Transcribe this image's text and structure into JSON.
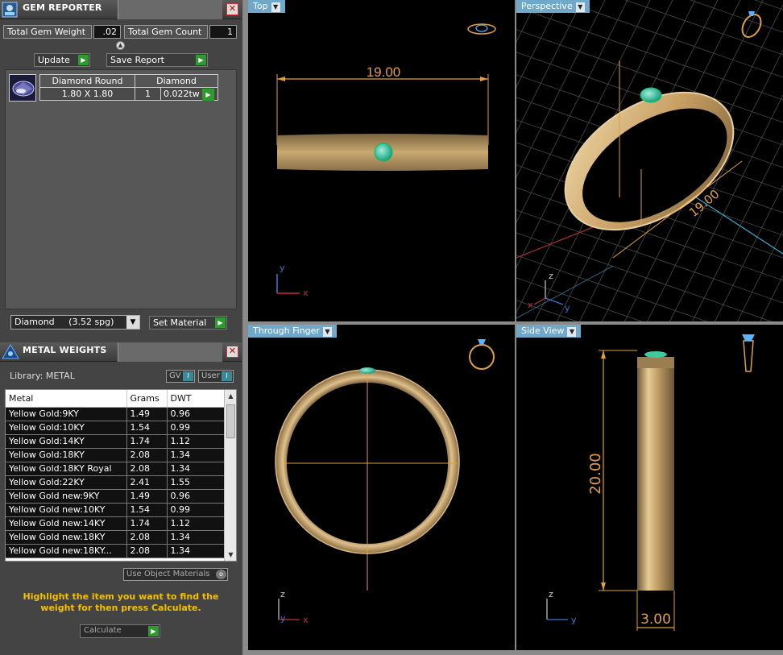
{
  "gem_reporter": {
    "title": "GEM REPORTER",
    "close": "✕",
    "total_weight_label": "Total Gem Weight",
    "total_weight_value": ".02",
    "total_count_label": "Total Gem Count",
    "total_count_value": "1",
    "update_label": "Update",
    "save_report_label": "Save Report",
    "gem": {
      "name": "Diamond Round",
      "material": "Diamond",
      "size": "1.80 X 1.80",
      "count": "1",
      "weight": "0.022tw"
    },
    "material_select": {
      "name": "Diamond",
      "spg": "(3.52 spg)"
    },
    "set_material_label": "Set Material"
  },
  "metal_weights": {
    "title": "METAL WEIGHTS",
    "close": "✕",
    "library_label": "Library: METAL",
    "gv_label": "GV",
    "user_label": "User",
    "columns": [
      "Metal",
      "Grams",
      "DWT"
    ],
    "rows": [
      [
        "Yellow Gold:9KY",
        "1.49",
        "0.96"
      ],
      [
        "Yellow Gold:10KY",
        "1.54",
        "0.99"
      ],
      [
        "Yellow Gold:14KY",
        "1.74",
        "1.12"
      ],
      [
        "Yellow Gold:18KY",
        "2.08",
        "1.34"
      ],
      [
        "Yellow Gold:18KY Royal",
        "2.08",
        "1.34"
      ],
      [
        "Yellow Gold:22KY",
        "2.41",
        "1.55"
      ],
      [
        "Yellow Gold new:9KY",
        "1.49",
        "0.96"
      ],
      [
        "Yellow Gold new:10KY",
        "1.54",
        "0.99"
      ],
      [
        "Yellow Gold new:14KY",
        "1.74",
        "1.12"
      ],
      [
        "Yellow Gold new:18KY",
        "2.08",
        "1.34"
      ],
      [
        "Yellow Gold new:18KY...",
        "2.08",
        "1.34"
      ]
    ],
    "use_object_materials_label": "Use Object Materials",
    "hint": "Highlight the item you want to find the weight for then press Calculate.",
    "calculate_label": "Calculate"
  },
  "viewports": {
    "top": {
      "label": "Top",
      "dimension": "19.00"
    },
    "perspective": {
      "label": "Perspective",
      "dimension": "19.00"
    },
    "through_finger": {
      "label": "Through Finger"
    },
    "side": {
      "label": "Side View",
      "height_dim": "20.00",
      "width_dim": "3.00"
    },
    "axes": {
      "x": "x",
      "y": "y",
      "z": "z"
    }
  },
  "colors": {
    "gold": "#c8a46a",
    "gem": "#38c8a0",
    "dimension_line": "#e0a040",
    "accent_yellow": "#f5c000",
    "tab_blue": "#6fa8c8"
  }
}
